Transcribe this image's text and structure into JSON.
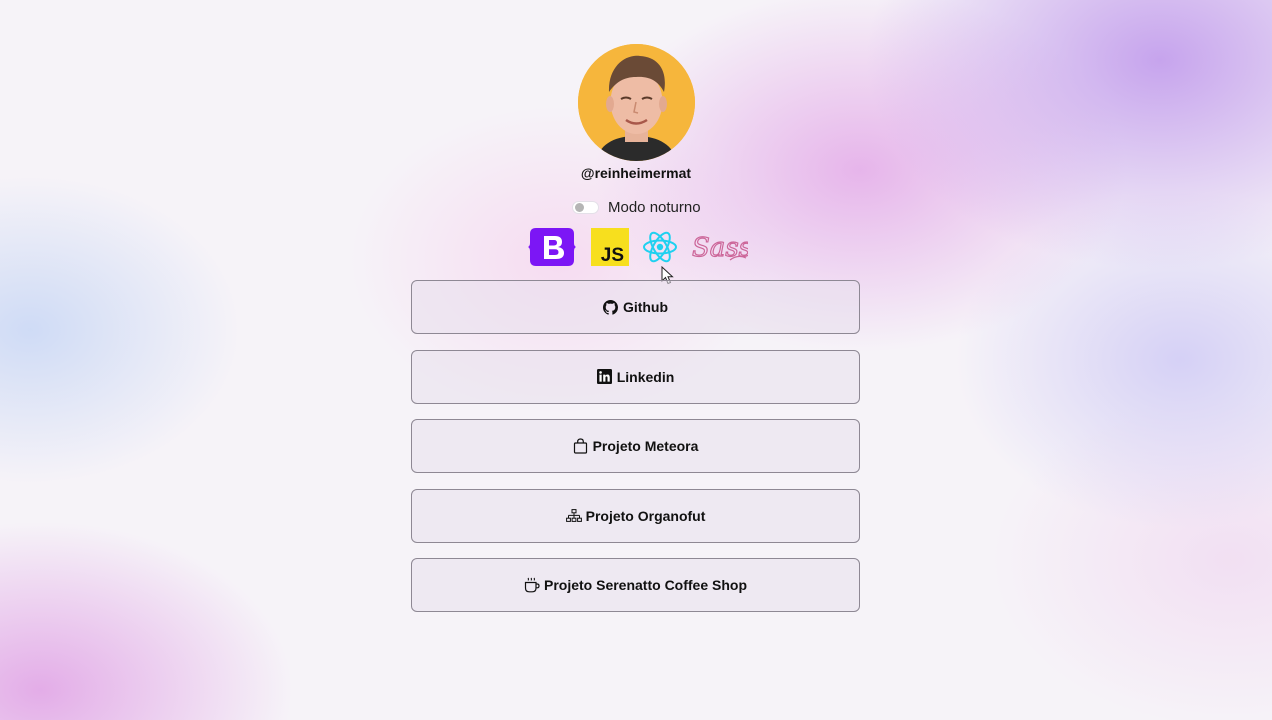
{
  "profile": {
    "username": "@reinheimermat",
    "avatar_icon": "profile-photo"
  },
  "theme_toggle": {
    "label": "Modo noturno",
    "checked": false
  },
  "tech_stack": [
    {
      "name": "Bootstrap",
      "icon": "bootstrap-icon",
      "color": "#7c16f5"
    },
    {
      "name": "JavaScript",
      "icon": "javascript-icon",
      "color": "#f7df1e"
    },
    {
      "name": "React",
      "icon": "react-icon",
      "color": "#1fd1f0"
    },
    {
      "name": "Sass",
      "icon": "sass-icon",
      "color": "#cc6699"
    }
  ],
  "links": [
    {
      "label": "Github",
      "icon": "github-icon"
    },
    {
      "label": "Linkedin",
      "icon": "linkedin-icon"
    },
    {
      "label": "Projeto Meteora",
      "icon": "shopping-bag-icon"
    },
    {
      "label": "Projeto Organofut",
      "icon": "org-chart-icon"
    },
    {
      "label": "Projeto Serenatto Coffee Shop",
      "icon": "coffee-cup-icon"
    }
  ],
  "colors": {
    "button_border": "#8e8894",
    "accent_purple": "#c49ae8",
    "accent_pink": "#e2a6e6"
  }
}
